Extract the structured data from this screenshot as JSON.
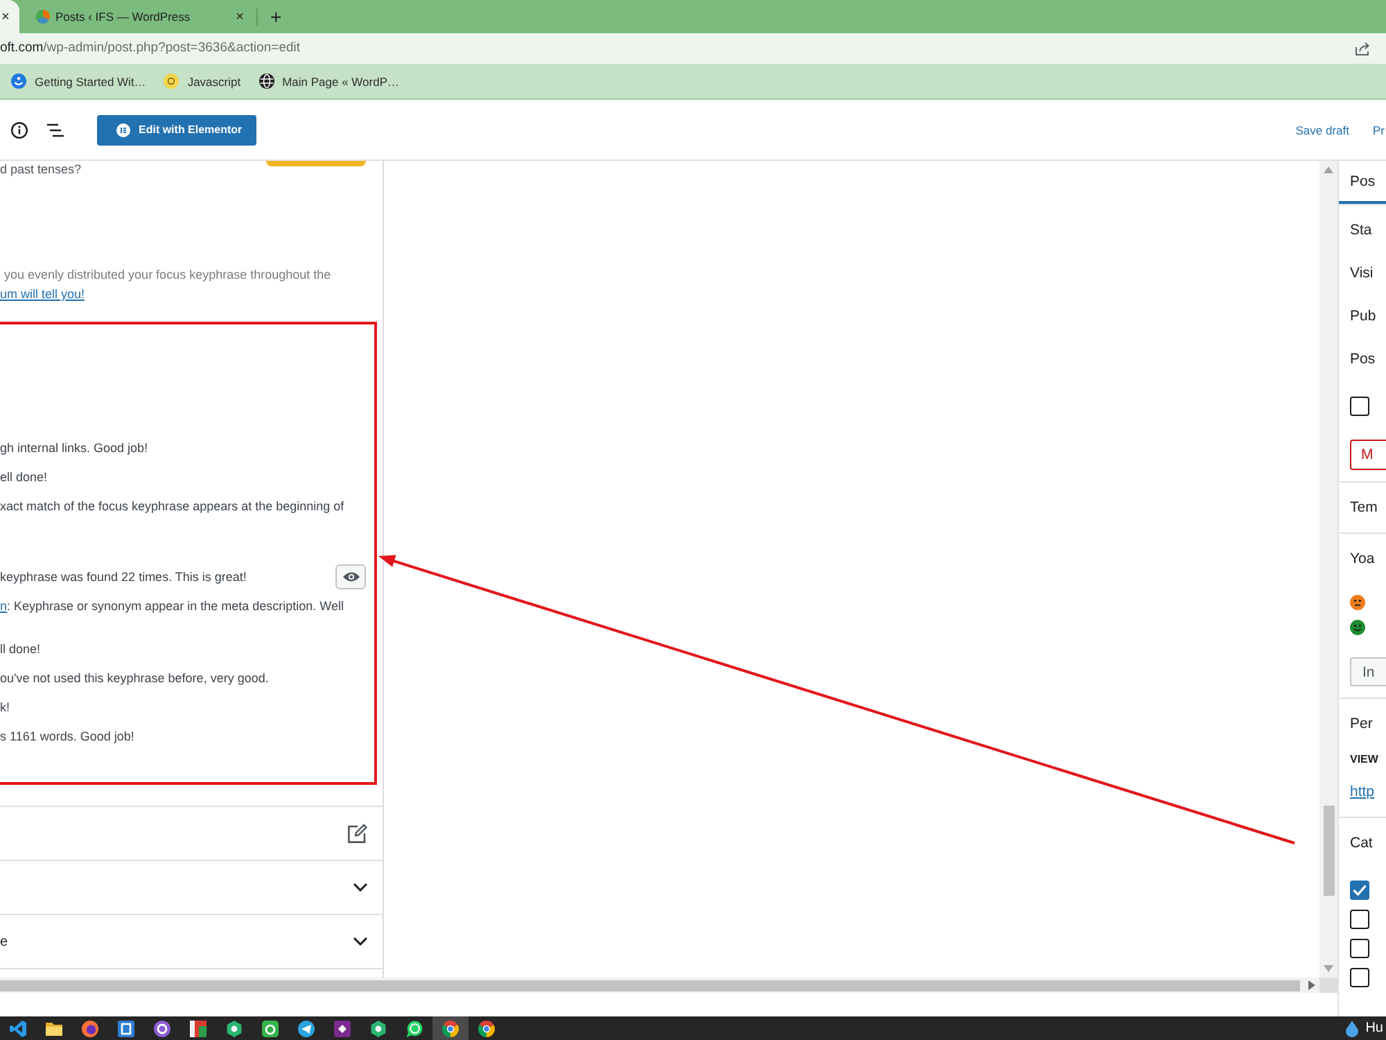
{
  "browser": {
    "tabs": [
      {
        "close": "×",
        "selected": true
      },
      {
        "title": "Posts ‹ IFS — WordPress",
        "close": "×",
        "selected": false
      }
    ],
    "new_tab": "+",
    "url": {
      "host": "oft.com",
      "path": "/wp-admin/post.php?post=3636&action=edit"
    },
    "bookmarks": [
      {
        "kind": "wave",
        "label": "Getting Started Wit…"
      },
      {
        "kind": "coin",
        "label": "Javascript"
      },
      {
        "kind": "globe",
        "label": "Main Page « WordP…"
      }
    ]
  },
  "toolbar": {
    "edit_button": "Edit with Elementor",
    "save_draft": "Save draft",
    "preview": "Pr"
  },
  "seo_panel": {
    "intro": "d past tenses?",
    "tip": {
      "text": "you evenly distributed your focus keyphrase throughout the",
      "link": "um will tell you!"
    },
    "results": [
      {
        "kind": "plain",
        "text": "gh internal links. Good job!"
      },
      {
        "kind": "plain",
        "text": "ell done!"
      },
      {
        "kind": "plain",
        "text": "xact match of the focus keyphrase appears at the beginning of"
      },
      {
        "kind": "markable",
        "text": "keyphrase was found 22 times. This is great!"
      },
      {
        "kind": "plain",
        "link": "n",
        "text": ": Keyphrase or synonym appear in the meta description. Well"
      },
      {
        "kind": "plain",
        "text": "ll done!"
      },
      {
        "kind": "plain",
        "text": "ou've not used this keyphrase before, very good."
      },
      {
        "kind": "plain",
        "text": "k!"
      },
      {
        "kind": "plain",
        "text": "s 1161 words. Good job!"
      }
    ],
    "sections": [
      {
        "kind": "edit"
      },
      {
        "kind": "collapsible",
        "expanded": false
      },
      {
        "kind": "collapsible",
        "label": "e",
        "expanded": false
      }
    ]
  },
  "sidebar": {
    "tab": {
      "label": "Pos",
      "selected": true
    },
    "sections": [
      {
        "rows": [
          {
            "kind": "heading",
            "label": "Sta"
          },
          {
            "kind": "text",
            "label": "Visi"
          },
          {
            "kind": "text",
            "label": "Pub"
          },
          {
            "kind": "text",
            "label": "Pos"
          },
          {
            "kind": "checkbox",
            "checked": false
          },
          {
            "kind": "danger",
            "label": "M"
          }
        ]
      },
      {
        "rows": [
          {
            "kind": "heading",
            "label": "Tem"
          }
        ]
      },
      {
        "rows": [
          {
            "kind": "heading",
            "label": "Yoa"
          },
          {
            "kind": "score",
            "smiling": false,
            "color": "#ee7c1b"
          },
          {
            "kind": "score",
            "smiling": true,
            "color": "#1e8c2f"
          },
          {
            "kind": "button",
            "label": "In"
          }
        ]
      },
      {
        "rows": [
          {
            "kind": "heading",
            "label": "Per"
          },
          {
            "kind": "caption",
            "label": "VIEW"
          },
          {
            "kind": "link",
            "label": "http"
          }
        ]
      },
      {
        "rows": [
          {
            "kind": "heading",
            "label": "Cat"
          },
          {
            "kind": "checkbox",
            "checked": true
          },
          {
            "kind": "checkbox",
            "checked": false
          },
          {
            "kind": "checkbox",
            "checked": false
          },
          {
            "kind": "checkbox",
            "checked": false
          }
        ]
      }
    ]
  },
  "taskbar": {
    "apps": [
      {
        "kind": "code",
        "selected": false
      },
      {
        "kind": "folder",
        "selected": false
      },
      {
        "kind": "orb",
        "selected": false
      },
      {
        "kind": "window",
        "selected": false
      },
      {
        "kind": "ring",
        "selected": false
      },
      {
        "kind": "cards",
        "selected": false
      },
      {
        "kind": "hexagon",
        "selected": false
      },
      {
        "kind": "tile",
        "selected": false
      },
      {
        "kind": "plane",
        "selected": false
      },
      {
        "kind": "diamond",
        "selected": false
      },
      {
        "kind": "hexagon",
        "selected": false
      },
      {
        "kind": "chat",
        "selected": false
      },
      {
        "kind": "wheel",
        "selected": true
      },
      {
        "kind": "wheel",
        "selected": false
      }
    ],
    "tray_text": "Hu"
  }
}
